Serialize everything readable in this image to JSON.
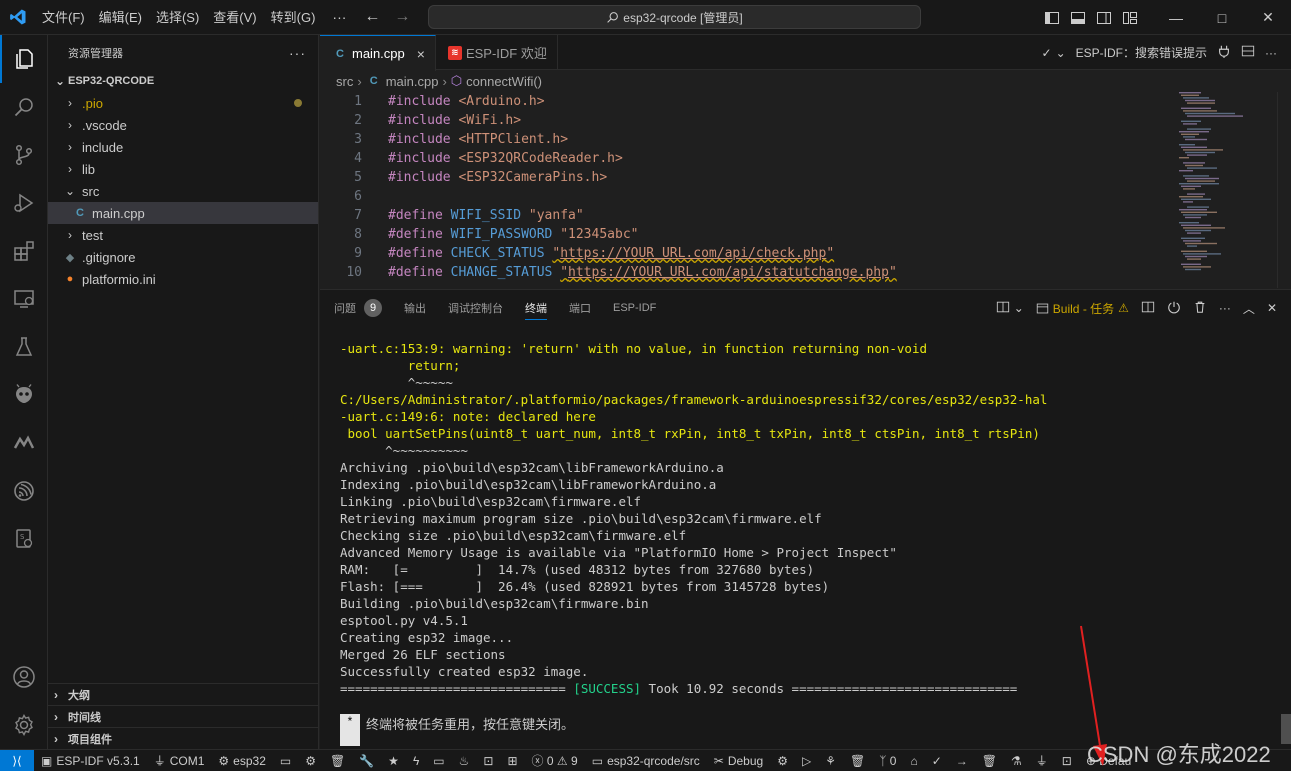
{
  "titlebar": {
    "menu": [
      "文件(F)",
      "编辑(E)",
      "选择(S)",
      "查看(V)",
      "转到(G)"
    ],
    "more": "···",
    "search": "esp32-qrcode [管理员]"
  },
  "sidebar": {
    "title": "资源管理器",
    "more": "···",
    "root": "ESP32-QRCODE",
    "items": [
      {
        "label": ".pio",
        "chev": "›"
      },
      {
        "label": ".vscode",
        "chev": "›"
      },
      {
        "label": "include",
        "chev": "›"
      },
      {
        "label": "lib",
        "chev": "›"
      },
      {
        "label": "src",
        "chev": "⌄"
      },
      {
        "label": "main.cpp"
      },
      {
        "label": "test",
        "chev": "›"
      },
      {
        "label": ".gitignore"
      },
      {
        "label": "platformio.ini"
      }
    ],
    "sections": [
      "大纲",
      "时间线",
      "项目组件"
    ]
  },
  "tabs": [
    {
      "label": "main.cpp",
      "close": "×"
    },
    {
      "label": "ESP-IDF 欢迎"
    }
  ],
  "tab_actions": {
    "label": "ESP-IDF：搜索错误提示"
  },
  "breadcrumb": [
    "src",
    "main.cpp",
    "connectWifi()"
  ],
  "code": {
    "line_numbers": [
      "1",
      "2",
      "3",
      "4",
      "5",
      "6",
      "7",
      "8",
      "9",
      "10"
    ],
    "include_kw": "#include",
    "define_kw": "#define",
    "includes": [
      "<Arduino.h>",
      "<WiFi.h>",
      "<HTTPClient.h>",
      "<ESP32QRCodeReader.h>",
      "<ESP32CameraPins.h>"
    ],
    "defines": [
      {
        "name": "WIFI_SSID",
        "value": "\"yanfa\""
      },
      {
        "name": "WIFI_PASSWORD",
        "value": "\"12345abc\""
      },
      {
        "name": "CHECK_STATUS",
        "value": "https://YOUR_URL.com/api/check.php"
      },
      {
        "name": "CHANGE_STATUS",
        "value": "https://YOUR_URL.com/api/statutchange.php"
      }
    ],
    "quote": "\""
  },
  "panel": {
    "tabs": [
      "问题",
      "输出",
      "调试控制台",
      "终端",
      "端口",
      "ESP-IDF"
    ],
    "problems_count": "9",
    "build_label": "Build - 任务",
    "terminal_lines": [
      {
        "text": "-uart.c:153:9: warning: 'return' with no value, in function returning non-void",
        "yellow": true
      },
      {
        "text": "         return;",
        "yellow": true
      },
      {
        "text": "         ^~~~~~",
        "yellow": false
      },
      {
        "text": "C:/Users/Administrator/.platformio/packages/framework-arduinoespressif32/cores/esp32/esp32-hal",
        "yellow": true
      },
      {
        "text": "-uart.c:149:6: note: declared here",
        "yellow": true
      },
      {
        "text": " bool uartSetPins(uint8_t uart_num, int8_t rxPin, int8_t txPin, int8_t ctsPin, int8_t rtsPin)",
        "yellow": true
      },
      {
        "text": "      ^~~~~~~~~~~",
        "yellow": false
      },
      {
        "text": "Archiving .pio\\build\\esp32cam\\libFrameworkArduino.a",
        "yellow": false
      },
      {
        "text": "Indexing .pio\\build\\esp32cam\\libFrameworkArduino.a",
        "yellow": false
      },
      {
        "text": "Linking .pio\\build\\esp32cam\\firmware.elf",
        "yellow": false
      },
      {
        "text": "Retrieving maximum program size .pio\\build\\esp32cam\\firmware.elf",
        "yellow": false
      },
      {
        "text": "Checking size .pio\\build\\esp32cam\\firmware.elf",
        "yellow": false
      },
      {
        "text": "Advanced Memory Usage is available via \"PlatformIO Home > Project Inspect\"",
        "yellow": false
      },
      {
        "text": "RAM:   [=         ]  14.7% (used 48312 bytes from 327680 bytes)",
        "yellow": false
      },
      {
        "text": "Flash: [===       ]  26.4% (used 828921 bytes from 3145728 bytes)",
        "yellow": false
      },
      {
        "text": "Building .pio\\build\\esp32cam\\firmware.bin",
        "yellow": false
      },
      {
        "text": "esptool.py v4.5.1",
        "yellow": false
      },
      {
        "text": "Creating esp32 image...",
        "yellow": false
      },
      {
        "text": "Merged 26 ELF sections",
        "yellow": false
      },
      {
        "text": "Successfully created esp32 image.",
        "yellow": false
      }
    ],
    "success_line": {
      "left": "============================== ",
      "tag": "[SUCCESS]",
      "right": " Took 10.92 seconds =============================="
    },
    "cursor_char": "*",
    "footer_msg": "终端将被任务重用，按任意键关闭。"
  },
  "statusbar": {
    "idf": "ESP-IDF v5.3.1",
    "com": "COM1",
    "target": "esp32",
    "errors": "0",
    "warnings": "9",
    "folder": "esp32-qrcode/src",
    "debug": "Debug",
    "ports": "0",
    "default": "Defau"
  },
  "watermark": "CSDN @东成2022",
  "colors": {
    "accent": "#0078d4",
    "warning": "#e5e510",
    "success": "#23d18b"
  }
}
